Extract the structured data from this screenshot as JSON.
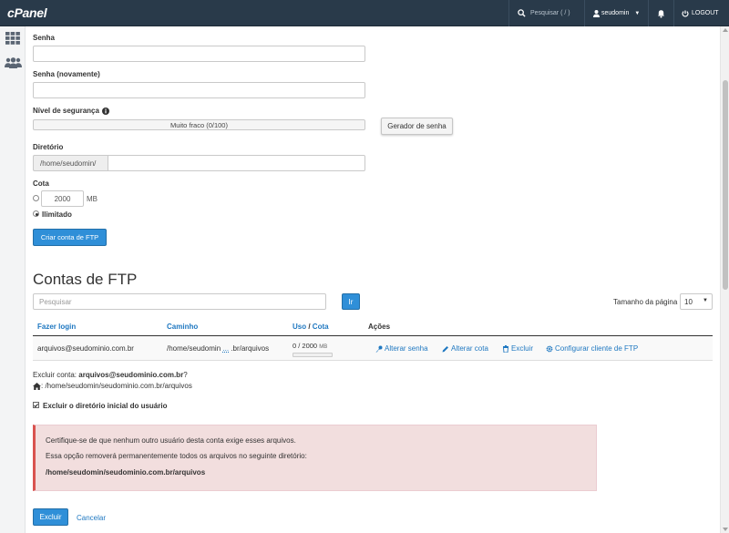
{
  "topbar": {
    "logo": "cPanel",
    "search_placeholder": "Pesquisar ( / )",
    "username": "seudomin",
    "logout": "LOGOUT"
  },
  "form": {
    "password_label": "Senha",
    "password_again_label": "Senha (novamente)",
    "strength_label": "Nível de segurança",
    "strength_value": "Muito fraco (0/100)",
    "strength_fraction": 0,
    "generator_button": "Gerador de senha",
    "directory_label": "Diretório",
    "directory_prefix": "/home/seudomin/",
    "directory_value": "",
    "quota_label": "Cota",
    "quota_value": "2000",
    "quota_unit": "MB",
    "unlimited_label": "Ilimitado",
    "create_button": "Criar conta de FTP"
  },
  "accounts": {
    "heading": "Contas de FTP",
    "search_placeholder": "Pesquisar",
    "go_button": "Ir",
    "page_size_label": "Tamanho da página",
    "page_size_value": "10",
    "columns": {
      "login": "Fazer login",
      "path": "Caminho",
      "usage": "Uso",
      "usage_sep": " / ",
      "quota": "Cota",
      "actions": "Ações"
    },
    "row": {
      "login": "arquivos@seudominio.com.br",
      "path_start": "/home/seudomin",
      "path_ellipsis": "...",
      "path_end": ".br/arquivos",
      "usage": "0 / 2000",
      "usage_unit": "MB",
      "usage_fraction": 0,
      "actions": [
        "Alterar senha",
        "Alterar cota",
        "Excluir",
        "Configurar cliente de FTP"
      ]
    }
  },
  "delete": {
    "prompt_prefix": "Excluir conta: ",
    "account": "arquivos@seudominio.com.br",
    "prompt_suffix": "?",
    "home_path": ": /home/seudomin/seudominio.com.br/arquivos",
    "checkbox_label": "Excluir o diretório inicial do usuário",
    "warning_line1": "Certifique-se de que nenhum outro usuário desta conta exige esses arquivos.",
    "warning_line2": "Essa opção removerá permanentemente todos os arquivos no seguinte diretório:",
    "warning_path": "/home/seudomin/seudominio.com.br/arquivos",
    "delete_button": "Excluir",
    "cancel_link": "Cancelar"
  },
  "colors": {
    "topbar": "#293a4a",
    "accent": "#ff6c2c",
    "primary": "#2f8fd8",
    "link": "#1f78c1",
    "danger": "#d9534f"
  }
}
